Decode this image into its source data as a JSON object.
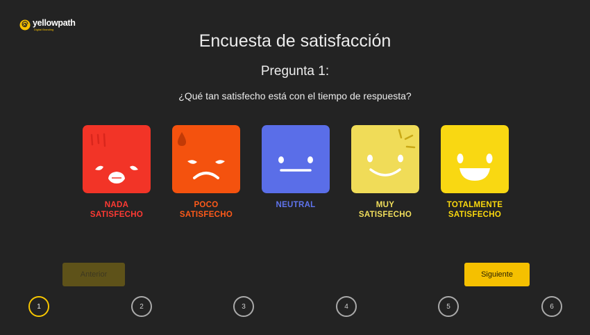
{
  "brand": {
    "name": "yellowpath",
    "tagline": "Digital Branding"
  },
  "survey": {
    "title": "Encuesta de satisfacción",
    "question_number": "Pregunta 1:",
    "question_text": "¿Qué tan satisfecho está con el tiempo de respuesta?"
  },
  "options": [
    {
      "label_line1": "NADA",
      "label_line2": "SATISFECHO",
      "color": "#f23427",
      "icon": "very-unhappy-face-icon"
    },
    {
      "label_line1": "POCO",
      "label_line2": "SATISFECHO",
      "color": "#f4520e",
      "icon": "sad-face-icon"
    },
    {
      "label_line1": "NEUTRAL",
      "label_line2": "",
      "color": "#5a6ee8",
      "icon": "neutral-face-icon"
    },
    {
      "label_line1": "MUY",
      "label_line2": "SATISFECHO",
      "color": "#f0dc58",
      "icon": "happy-face-icon"
    },
    {
      "label_line1": "TOTALMENTE",
      "label_line2": "SATISFECHO",
      "color": "#f9d812",
      "icon": "very-happy-face-icon"
    }
  ],
  "nav": {
    "prev_label": "Anterior",
    "next_label": "Siguiente"
  },
  "steps": [
    "1",
    "2",
    "3",
    "4",
    "5",
    "6"
  ],
  "active_step": "1"
}
